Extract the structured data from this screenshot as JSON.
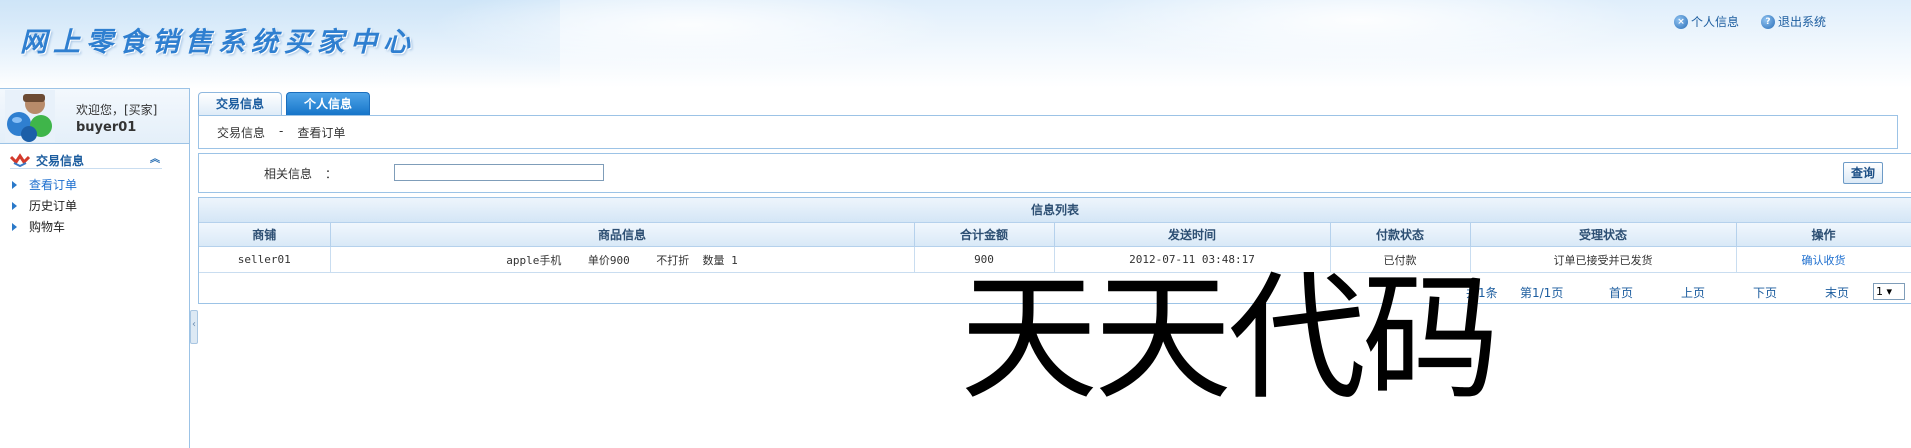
{
  "header": {
    "site_title": "网上零食销售系统买家中心",
    "links": [
      {
        "label": "个人信息",
        "icon": "close-circle-icon"
      },
      {
        "label": "退出系统",
        "icon": "help-circle-icon"
      }
    ]
  },
  "sidebar": {
    "welcome": "欢迎您，[买家]",
    "username": "buyer01",
    "group_label": "交易信息",
    "items": [
      {
        "label": "查看订单",
        "active": true
      },
      {
        "label": "历史订单",
        "active": false
      },
      {
        "label": "购物车",
        "active": false
      }
    ]
  },
  "tabs": [
    {
      "label": "交易信息"
    },
    {
      "label": "个人信息"
    }
  ],
  "breadcrumb": {
    "section": "交易信息",
    "separator": "-",
    "page": "查看订单"
  },
  "search": {
    "label": "相关信息",
    "colon": "：",
    "value": "",
    "button": "查询"
  },
  "list": {
    "title": "信息列表",
    "columns": [
      "商铺",
      "商品信息",
      "合计金额",
      "发送时间",
      "付款状态",
      "受理状态",
      "操作"
    ],
    "rows": [
      {
        "shop": "seller01",
        "product": "apple手机    单价900    不打折  数量 1",
        "total": "900",
        "time": "2012-07-11 03:48:17",
        "pay_status": "已付款",
        "process_status": "订单已接受并已发货",
        "action": "确认收货"
      }
    ]
  },
  "pager": {
    "total": "共1条",
    "page": "第1/1页",
    "first": "首页",
    "prev": "上页",
    "next": "下页",
    "last": "末页",
    "select_value": "1 ▾"
  },
  "watermark": "天天代码",
  "colors": {
    "accent": "#1675c9",
    "link": "#1e6fcf",
    "border": "#9cc3e6"
  }
}
